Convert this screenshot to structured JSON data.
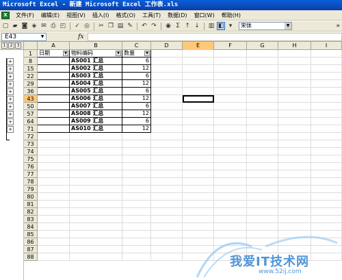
{
  "window": {
    "title": "Microsoft Excel - 新建 Microsoft Excel 工作表.xls"
  },
  "menu": [
    "文件(F)",
    "编辑(E)",
    "视图(V)",
    "插入(I)",
    "格式(O)",
    "工具(T)",
    "数据(D)",
    "窗口(W)",
    "帮助(H)"
  ],
  "toolbar": {
    "font_name": "宋体",
    "more": "»"
  },
  "formula": {
    "name_box": "E43",
    "fx": "fx",
    "content": ""
  },
  "outline_levels": [
    "1",
    "2",
    "3"
  ],
  "expand_symbol": "+",
  "columns": [
    "A",
    "B",
    "C",
    "D",
    "E",
    "F",
    "G",
    "H",
    "I"
  ],
  "selected_column": "E",
  "header_row": {
    "number": "1",
    "cells": [
      "日期",
      "物料编码",
      "数量"
    ]
  },
  "rows": [
    {
      "number": "8",
      "code": "AS001 汇总",
      "qty": "6"
    },
    {
      "number": "15",
      "code": "AS002 汇总",
      "qty": "12"
    },
    {
      "number": "22",
      "code": "AS003 汇总",
      "qty": "6"
    },
    {
      "number": "29",
      "code": "AS004 汇总",
      "qty": "12"
    },
    {
      "number": "36",
      "code": "AS005 汇总",
      "qty": "6"
    },
    {
      "number": "43",
      "code": "AS006 汇总",
      "qty": "12"
    },
    {
      "number": "50",
      "code": "AS007 汇总",
      "qty": "6"
    },
    {
      "number": "57",
      "code": "AS008 汇总",
      "qty": "12"
    },
    {
      "number": "64",
      "code": "AS009 汇总",
      "qty": "6"
    },
    {
      "number": "71",
      "code": "AS010 汇总",
      "qty": "12"
    }
  ],
  "empty_rows": [
    "72",
    "73",
    "74",
    "75",
    "76",
    "77",
    "78",
    "79",
    "80",
    "81",
    "82",
    "83",
    "84",
    "85",
    "86",
    "87",
    "88"
  ],
  "selected_row": "43",
  "watermark": {
    "text": "我爱IT技术网",
    "url": "www.52ij.com"
  }
}
